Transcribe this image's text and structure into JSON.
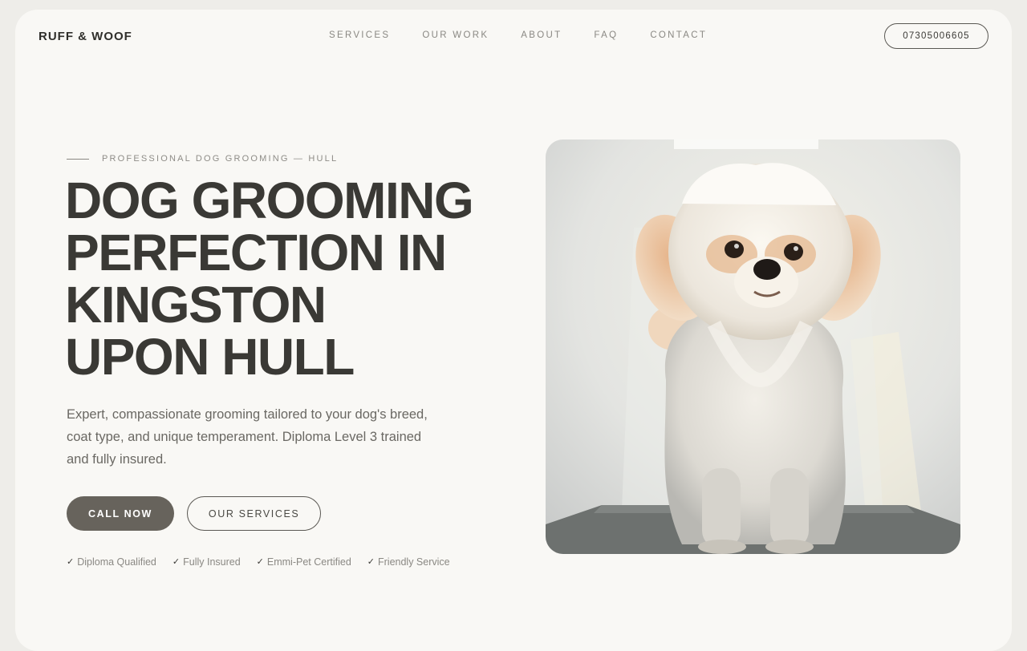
{
  "brand": "RUFF & WOOF",
  "nav": {
    "items": [
      "SERVICES",
      "OUR WORK",
      "ABOUT",
      "FAQ",
      "CONTACT"
    ]
  },
  "phone": "07305006605",
  "hero": {
    "eyebrow": "PROFESSIONAL DOG GROOMING — HULL",
    "headline_lines": [
      "DOG GROOMING",
      "PERFECTION IN",
      "KINGSTON",
      "UPON HULL"
    ],
    "lede": "Expert, compassionate grooming tailored to your dog's breed, coat type, and unique temperament. Diploma Level 3 trained and fully insured.",
    "primary_cta": "CALL NOW",
    "secondary_cta": "OUR SERVICES",
    "badges": [
      "Diploma Qualified",
      "Fully Insured",
      "Emmi-Pet Certified",
      "Friendly Service"
    ],
    "badge_icon": "check-icon",
    "image_alt": "fluffy-dog-photo"
  },
  "colors": {
    "background": "#f9f8f5",
    "text": "#3a3935",
    "primary_button": "#67635c",
    "muted": "#8a8883"
  }
}
